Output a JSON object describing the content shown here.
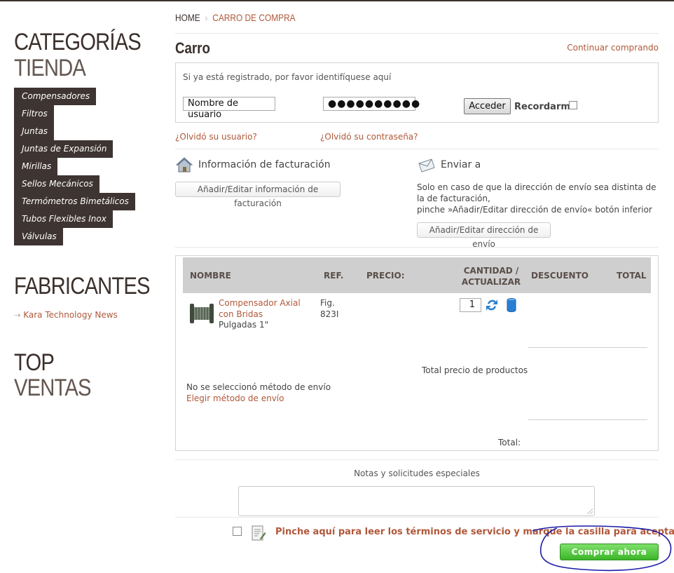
{
  "sidebar": {
    "categories_title_1": "CATEGORÍAS",
    "categories_title_2": "TIENDA",
    "categories": [
      "Compensadores",
      "Filtros",
      "Juntas",
      "Juntas de Expansión",
      "Mirillas",
      "Sellos Mecánicos",
      "Termómetros Bimetálicos",
      "Tubos Flexibles Inox",
      "Válvulas"
    ],
    "manufacturers_title": "FABRICANTES",
    "manufacturers": [
      "Kara Technology News"
    ],
    "top_title_1": "TOP",
    "top_title_2": "VENTAS"
  },
  "breadcrumb": {
    "home": "HOME",
    "current": "CARRO DE COMPRA"
  },
  "cart": {
    "title": "Carro",
    "continue": "Continuar comprando"
  },
  "login": {
    "message": "Si ya está registrado, por favor identifíquese aquí",
    "username_value": "Nombre de usuario",
    "password_value": "●●●●●●●●●●",
    "submit": "Acceder",
    "remember": "Recordarme",
    "forgot_user": "¿Olvidó su usuario?",
    "forgot_pass": "¿Olvidó su contraseña?"
  },
  "billing": {
    "title": "Información de facturación",
    "button": "Añadir/Editar información de facturación",
    "icon": "house-icon"
  },
  "shipping": {
    "title": "Enviar a",
    "note": "Solo en caso de que la dirección de envío sea distinta de la de facturación,\npinche »Añadir/Editar dirección de envío« botón inferior",
    "button": "Añadir/Editar dirección de envío",
    "icon": "envelope-icon"
  },
  "table": {
    "headers": {
      "name": "NOMBRE",
      "ref": "REF.",
      "price": "PRECIO:",
      "qty_1": "CANTIDAD /",
      "qty_2": "ACTUALIZAR",
      "discount": "DESCUENTO",
      "total": "TOTAL"
    },
    "rows": [
      {
        "name": "Compensador Axial con Bridas",
        "sub": "Pulgadas 1\"",
        "ref_1": "Fig.",
        "ref_2": "823I",
        "qty": "1"
      }
    ],
    "products_total_label": "Total precio de productos",
    "no_shipping": "No se seleccionó método de envío",
    "choose_shipping": "Elegir método de envío",
    "total_label": "Total:"
  },
  "notes": {
    "label": "Notas y solicitudes especiales"
  },
  "tos": {
    "text": "Pinche aquí para leer los términos de servicio y marque la casilla para aceptarlos."
  },
  "checkout": {
    "button": "Comprar ahora"
  },
  "colors": {
    "accent": "#b0583a",
    "sidebar_bg": "#3e3431",
    "buy_green": "#3cb528",
    "annotation": "#1a1aa8"
  }
}
